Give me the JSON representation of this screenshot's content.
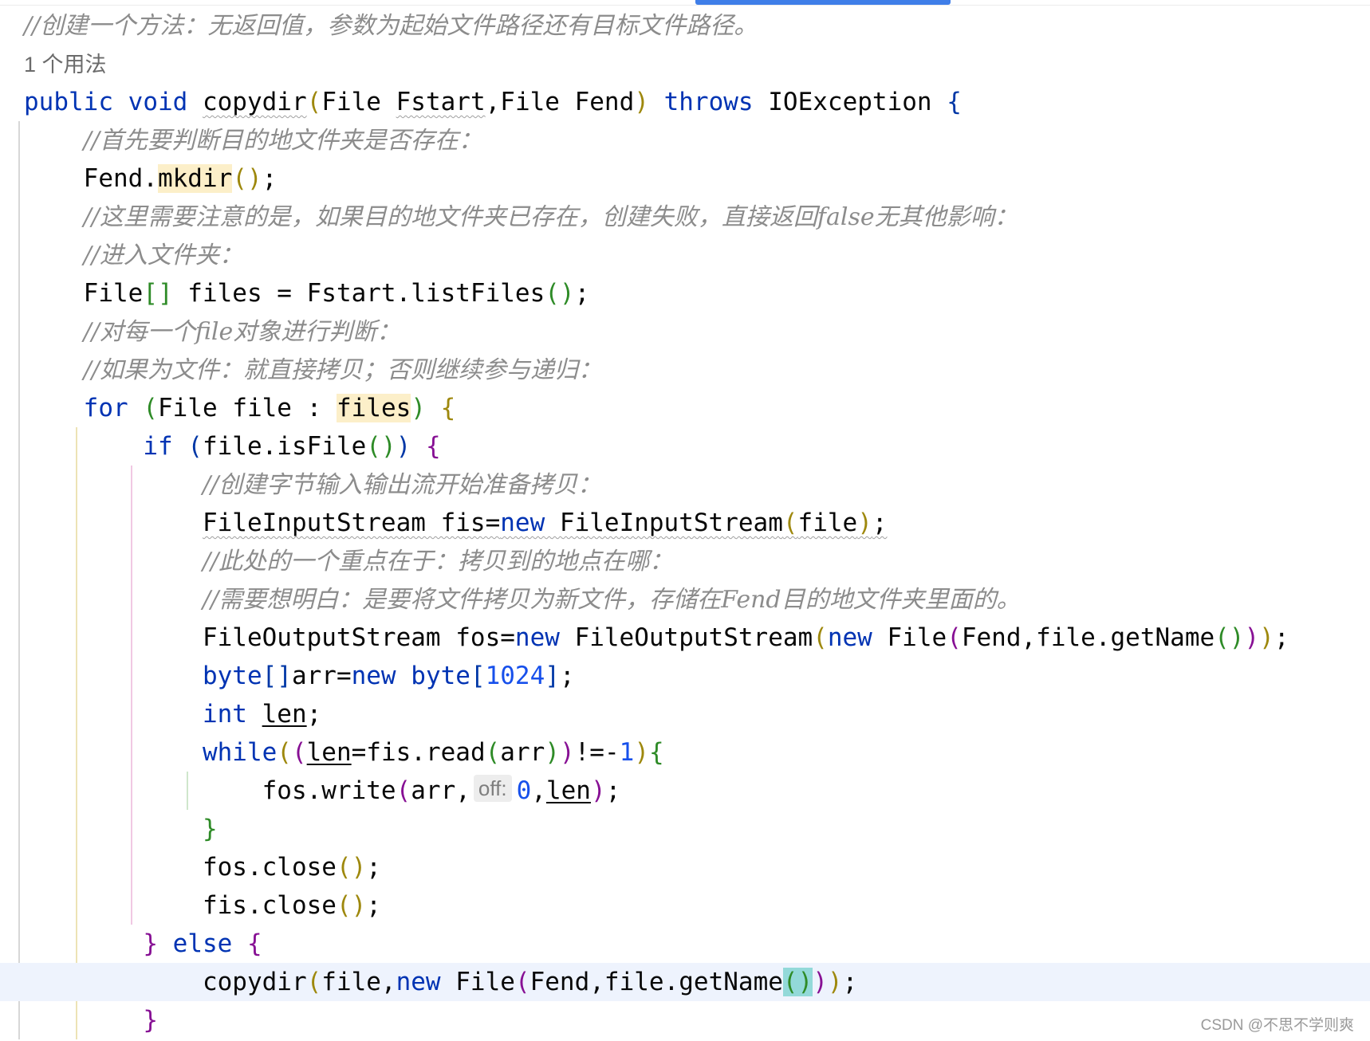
{
  "editor": {
    "language": "java",
    "usage_hint": "1 个用法",
    "param_hint": "off:",
    "watermark": "CSDN @不思不学则爽",
    "lines": [
      [
        {
          "t": "//创建一个方法：无返回值，参数为起始文件路径还有目标文件路径。",
          "c": "cm"
        }
      ],
      [
        {
          "t": "1 个用法",
          "c": "usage"
        }
      ],
      [
        {
          "t": "public",
          "c": "kw"
        },
        {
          "t": " "
        },
        {
          "t": "void",
          "c": "kw"
        },
        {
          "t": " "
        },
        {
          "t": "copydir",
          "c": "wavy"
        },
        {
          "t": "(",
          "c": "b1"
        },
        {
          "t": "File "
        },
        {
          "t": "Fstart",
          "c": "wavy"
        },
        {
          "t": ",File Fend"
        },
        {
          "t": ")",
          "c": "b1"
        },
        {
          "t": " "
        },
        {
          "t": "throws",
          "c": "kw"
        },
        {
          "t": " IOException "
        },
        {
          "t": "{",
          "c": "b4"
        }
      ],
      [
        {
          "t": "    "
        },
        {
          "t": "//首先要判断目的地文件夹是否存在：",
          "c": "cm"
        }
      ],
      [
        {
          "t": "    Fend."
        },
        {
          "t": "mkdir",
          "c": "hl"
        },
        {
          "t": "()",
          "c": "b1"
        },
        {
          "t": ";"
        }
      ],
      [
        {
          "t": "    "
        },
        {
          "t": "//这里需要注意的是，如果目的地文件夹已存在，创建失败，直接返回false无其他影响：",
          "c": "cm"
        }
      ],
      [
        {
          "t": "    "
        },
        {
          "t": "//进入文件夹：",
          "c": "cm"
        }
      ],
      [
        {
          "t": "    File"
        },
        {
          "t": "[]",
          "c": "b3"
        },
        {
          "t": " files = Fstart.listFiles"
        },
        {
          "t": "()",
          "c": "b3"
        },
        {
          "t": ";"
        }
      ],
      [
        {
          "t": "    "
        },
        {
          "t": "//对每一个file对象进行判断：",
          "c": "cm"
        }
      ],
      [
        {
          "t": "    "
        },
        {
          "t": "//如果为文件：就直接拷贝；否则继续参与递归：",
          "c": "cm"
        }
      ],
      [
        {
          "t": "    "
        },
        {
          "t": "for",
          "c": "kw"
        },
        {
          "t": " "
        },
        {
          "t": "(",
          "c": "b3"
        },
        {
          "t": "File file : "
        },
        {
          "t": "files",
          "c": "hl"
        },
        {
          "t": ")",
          "c": "b3"
        },
        {
          "t": " "
        },
        {
          "t": "{",
          "c": "b1"
        }
      ],
      [
        {
          "t": "        "
        },
        {
          "t": "if",
          "c": "kw"
        },
        {
          "t": " "
        },
        {
          "t": "(",
          "c": "b4"
        },
        {
          "t": "file.isFile"
        },
        {
          "t": "()",
          "c": "b3"
        },
        {
          "t": ")",
          "c": "b4"
        },
        {
          "t": " "
        },
        {
          "t": "{",
          "c": "b2"
        }
      ],
      [
        {
          "t": "            "
        },
        {
          "t": "//创建字节输入输出流开始准备拷贝：",
          "c": "cm"
        }
      ],
      [
        {
          "t": "            "
        },
        {
          "t": "FileInputStream fis=",
          "c": "wavy"
        },
        {
          "t": "new",
          "c": "kw wavy"
        },
        {
          "t": " FileInputStream",
          "c": "wavy"
        },
        {
          "t": "(",
          "c": "b1 wavy"
        },
        {
          "t": "file",
          "c": "wavy"
        },
        {
          "t": ")",
          "c": "b1 wavy"
        },
        {
          "t": ";",
          "c": "wavy"
        }
      ],
      [
        {
          "t": "            "
        },
        {
          "t": "//此处的一个重点在于：拷贝到的地点在哪：",
          "c": "cm"
        }
      ],
      [
        {
          "t": "            "
        },
        {
          "t": "//需要想明白：是要将文件拷贝为新文件，存储在Fend目的地文件夹里面的。",
          "c": "cm"
        }
      ],
      [
        {
          "t": "            FileOutputStream fos="
        },
        {
          "t": "new",
          "c": "kw"
        },
        {
          "t": " FileOutputStream"
        },
        {
          "t": "(",
          "c": "b1"
        },
        {
          "t": "new",
          "c": "kw"
        },
        {
          "t": " File"
        },
        {
          "t": "(",
          "c": "b2"
        },
        {
          "t": "Fend,file.getName"
        },
        {
          "t": "()",
          "c": "b3"
        },
        {
          "t": ")",
          "c": "b2"
        },
        {
          "t": ")",
          "c": "b1"
        },
        {
          "t": ";"
        }
      ],
      [
        {
          "t": "            "
        },
        {
          "t": "byte",
          "c": "kw"
        },
        {
          "t": "[]",
          "c": "b4"
        },
        {
          "t": "arr="
        },
        {
          "t": "new",
          "c": "kw"
        },
        {
          "t": " "
        },
        {
          "t": "byte",
          "c": "kw"
        },
        {
          "t": "[",
          "c": "b4"
        },
        {
          "t": "1024",
          "c": "num"
        },
        {
          "t": "]",
          "c": "b4"
        },
        {
          "t": ";"
        }
      ],
      [
        {
          "t": "            "
        },
        {
          "t": "int",
          "c": "kw"
        },
        {
          "t": " "
        },
        {
          "t": "len",
          "c": "mut"
        },
        {
          "t": ";"
        }
      ],
      [
        {
          "t": "            "
        },
        {
          "t": "while",
          "c": "kw"
        },
        {
          "t": "(",
          "c": "b1"
        },
        {
          "t": "(",
          "c": "b2"
        },
        {
          "t": "len",
          "c": "mut"
        },
        {
          "t": "=fis.read"
        },
        {
          "t": "(",
          "c": "b3"
        },
        {
          "t": "arr"
        },
        {
          "t": ")",
          "c": "b3"
        },
        {
          "t": ")",
          "c": "b2"
        },
        {
          "t": "!=-"
        },
        {
          "t": "1",
          "c": "num"
        },
        {
          "t": ")",
          "c": "b1"
        },
        {
          "t": "{",
          "c": "b3"
        }
      ],
      [
        {
          "t": "                fos.write"
        },
        {
          "t": "(",
          "c": "b2"
        },
        {
          "t": "arr,"
        },
        {
          "t": "off:",
          "c": "hint"
        },
        {
          "t": "0",
          "c": "num"
        },
        {
          "t": ","
        },
        {
          "t": "len",
          "c": "mut"
        },
        {
          "t": ")",
          "c": "b2"
        },
        {
          "t": ";"
        }
      ],
      [
        {
          "t": "            "
        },
        {
          "t": "}",
          "c": "b3"
        }
      ],
      [
        {
          "t": "            fos.close"
        },
        {
          "t": "()",
          "c": "b1"
        },
        {
          "t": ";"
        }
      ],
      [
        {
          "t": "            fis.close"
        },
        {
          "t": "()",
          "c": "b1"
        },
        {
          "t": ";"
        }
      ],
      [
        {
          "t": "        "
        },
        {
          "t": "}",
          "c": "b2"
        },
        {
          "t": " "
        },
        {
          "t": "else",
          "c": "kw"
        },
        {
          "t": " "
        },
        {
          "t": "{",
          "c": "b2"
        }
      ],
      [
        {
          "t": "            copydir"
        },
        {
          "t": "(",
          "c": "b1"
        },
        {
          "t": "file,"
        },
        {
          "t": "new",
          "c": "kw"
        },
        {
          "t": " File"
        },
        {
          "t": "(",
          "c": "b2"
        },
        {
          "t": "Fend,file.getName"
        },
        {
          "t": "()",
          "c": "b3 match"
        },
        {
          "t": ")",
          "c": "b2"
        },
        {
          "t": ")",
          "c": "b1"
        },
        {
          "t": ";"
        }
      ],
      [
        {
          "t": "        "
        },
        {
          "t": "}",
          "c": "b2"
        }
      ]
    ]
  }
}
